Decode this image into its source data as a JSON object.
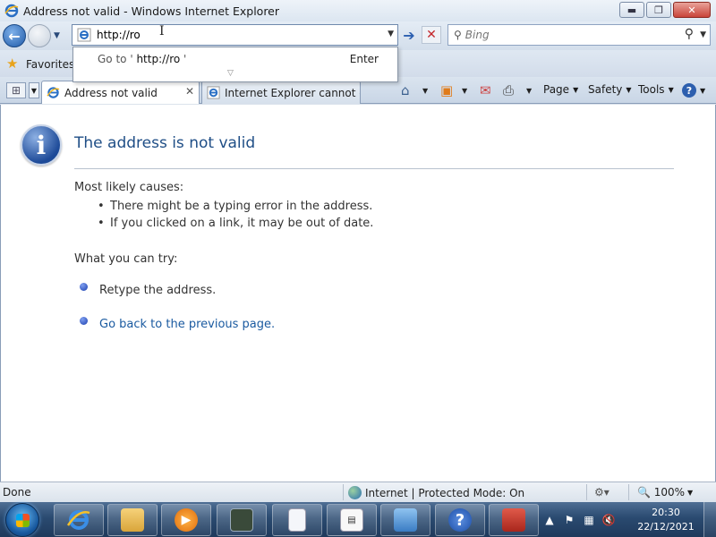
{
  "window": {
    "title": "Address not valid - Windows Internet Explorer",
    "minimize": "▬",
    "maximize": "❐",
    "close": "✕"
  },
  "nav": {
    "address_value": "http://ro",
    "search_placeholder": "Bing"
  },
  "autocomplete": {
    "goto_prefix": "Go to '",
    "goto_url": "http://ro",
    "goto_suffix": " '",
    "enter_label": "Enter"
  },
  "favorites": {
    "label": "Favorites"
  },
  "tabs": [
    {
      "label": "Address not valid",
      "active": true
    },
    {
      "label": "Internet Explorer cannot di...",
      "active": false
    }
  ],
  "command_bar": {
    "page": "Page",
    "safety": "Safety",
    "tools": "Tools",
    "help": "?"
  },
  "content": {
    "title": "The address is not valid",
    "causes_heading": "Most likely causes:",
    "causes": [
      "There might be a typing error in the address.",
      "If you clicked on a link, it may be out of date."
    ],
    "try_heading": "What you can try:",
    "try_items": [
      {
        "text": "Retype the address.",
        "is_link": false
      },
      {
        "text": "Go back to the previous page.",
        "is_link": true
      }
    ]
  },
  "status": {
    "text": "Done",
    "zone": "Internet | Protected Mode: On",
    "zoom": "100%"
  },
  "taskbar": {
    "time": "20:30",
    "date": "22/12/2021"
  },
  "colors": {
    "link": "#1a5aa0",
    "title": "#1f4e86",
    "taskbar": "#2a4a70"
  }
}
